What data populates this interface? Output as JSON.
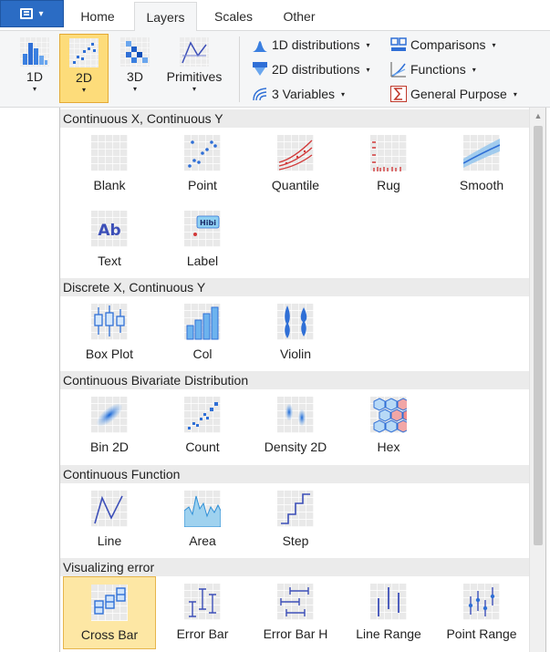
{
  "tabs": {
    "home": "Home",
    "layers": "Layers",
    "scales": "Scales",
    "other": "Other"
  },
  "app_menu": {
    "caret": "▾"
  },
  "ribbon": {
    "buttons": {
      "b1d": "1D",
      "b2d": "2D",
      "b3d": "3D",
      "primitives": "Primitives",
      "dropdown_glyph": "▾"
    },
    "items": {
      "dist1d": "1D distributions",
      "dist2d": "2D distributions",
      "vars3": "3 Variables",
      "comparisons": "Comparisons",
      "functions": "Functions",
      "general": "General Purpose",
      "caret": "▾"
    }
  },
  "gallery": {
    "sections": {
      "cxcy": "Continuous X, Continuous Y",
      "dxcy": "Discrete X, Continuous Y",
      "cbd": "Continuous Bivariate Distribution",
      "cf": "Continuous Function",
      "ve": "Visualizing error"
    },
    "items": {
      "blank": "Blank",
      "point": "Point",
      "quantile": "Quantile",
      "rug": "Rug",
      "smooth": "Smooth",
      "text": "Text",
      "label": "Label",
      "boxplot": "Box Plot",
      "col": "Col",
      "violin": "Violin",
      "bin2d": "Bin 2D",
      "count": "Count",
      "density2d": "Density 2D",
      "hex": "Hex",
      "line": "Line",
      "area": "Area",
      "step": "Step",
      "crossbar": "Cross Bar",
      "errorbar": "Error Bar",
      "errorbarh": "Error Bar H",
      "linerange": "Line Range",
      "pointrange": "Point Range"
    },
    "icon_text": {
      "text_ab": "Ab",
      "label_hibi": "Hibi"
    },
    "scroll_up": "▲"
  },
  "colors": {
    "accent": "#2b6cc4",
    "pressed": "#fddc7a",
    "selected": "#fde7a4",
    "icon_blue": "#2f6fd6"
  }
}
